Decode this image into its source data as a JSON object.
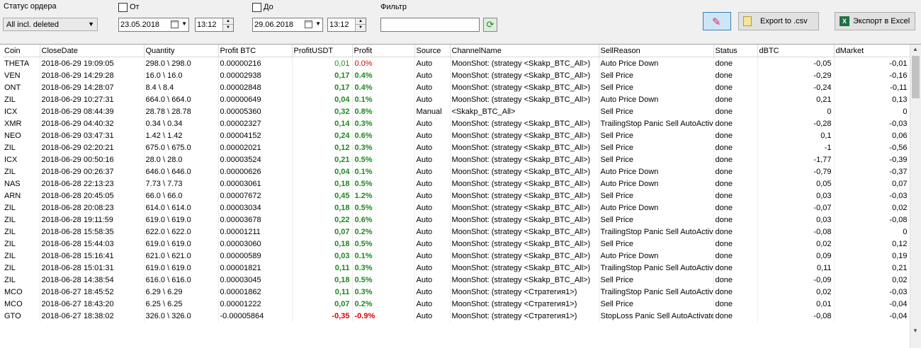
{
  "toolbar": {
    "status_label": "Статус ордера",
    "status_value": "All incl. deleted",
    "from_label": "От",
    "from_date": "23.05.2018",
    "from_time": "13:12",
    "to_label": "До",
    "to_date": "29.06.2018",
    "to_time": "13:12",
    "filter_label": "Фильтр",
    "filter_value": "",
    "export_csv": "Export to .csv",
    "export_excel": "Экспорт в Excel"
  },
  "columns": [
    "Coin",
    "CloseDate",
    "Quantity",
    "Profit BTC",
    "ProfitUSDT",
    "Profit",
    "Source",
    "ChannelName",
    "SellReason",
    "Status",
    "dBTC",
    "dMarket"
  ],
  "rows": [
    [
      "THETA",
      "2018-06-29 19:09:05",
      "298.0 \\ 298.0",
      "0.00000216",
      "0,01",
      "0.0%",
      "Auto",
      "MoonShot: (strategy <Skakp_BTC_All>)",
      "Auto Price Down",
      "done",
      "-0,05",
      "-0,01"
    ],
    [
      "VEN",
      "2018-06-29 14:29:28",
      "16.0 \\ 16.0",
      "0.00002938",
      "0,17",
      "0.4%",
      "Auto",
      "MoonShot: (strategy <Skakp_BTC_All>)",
      "Sell Price",
      "done",
      "-0,29",
      "-0,16"
    ],
    [
      "ONT",
      "2018-06-29 14:28:07",
      "8.4 \\ 8.4",
      "0.00002848",
      "0,17",
      "0.4%",
      "Auto",
      "MoonShot: (strategy <Skakp_BTC_All>)",
      "Sell Price",
      "done",
      "-0,24",
      "-0,11"
    ],
    [
      "ZIL",
      "2018-06-29 10:27:31",
      "664.0 \\ 664.0",
      "0.00000649",
      "0,04",
      "0.1%",
      "Auto",
      "MoonShot: (strategy <Skakp_BTC_All>)",
      "Auto Price Down",
      "done",
      "0,21",
      "0,13"
    ],
    [
      "ICX",
      "2018-06-29 08:44:39",
      "28.78 \\ 28.78",
      "0.00005360",
      "0,32",
      "0.8%",
      "Manual",
      " <Skakp_BTC_All>",
      "Sell Price",
      "done",
      "0",
      "0"
    ],
    [
      "XMR",
      "2018-06-29 04:40:32",
      "0.34 \\ 0.34",
      "0.00002327",
      "0,14",
      "0.3%",
      "Auto",
      "MoonShot: (strategy <Skakp_BTC_All>)",
      "TrailingStop Panic Sell AutoActivated",
      "done",
      "-0,28",
      "-0,03"
    ],
    [
      "NEO",
      "2018-06-29 03:47:31",
      "1.42 \\ 1.42",
      "0.00004152",
      "0,24",
      "0.6%",
      "Auto",
      "MoonShot: (strategy <Skakp_BTC_All>)",
      "Sell Price",
      "done",
      "0,1",
      "0,06"
    ],
    [
      "ZIL",
      "2018-06-29 02:20:21",
      "675.0 \\ 675.0",
      "0.00002021",
      "0,12",
      "0.3%",
      "Auto",
      "MoonShot: (strategy <Skakp_BTC_All>)",
      "Sell Price",
      "done",
      "-1",
      "-0,56"
    ],
    [
      "ICX",
      "2018-06-29 00:50:16",
      "28.0 \\ 28.0",
      "0.00003524",
      "0,21",
      "0.5%",
      "Auto",
      "MoonShot: (strategy <Skakp_BTC_All>)",
      "Sell Price",
      "done",
      "-1,77",
      "-0,39"
    ],
    [
      "ZIL",
      "2018-06-29 00:26:37",
      "646.0 \\ 646.0",
      "0.00000626",
      "0,04",
      "0.1%",
      "Auto",
      "MoonShot: (strategy <Skakp_BTC_All>)",
      "Auto Price Down",
      "done",
      "-0,79",
      "-0,37"
    ],
    [
      "NAS",
      "2018-06-28 22:13:23",
      "7.73 \\ 7.73",
      "0.00003061",
      "0,18",
      "0.5%",
      "Auto",
      "MoonShot: (strategy <Skakp_BTC_All>)",
      "Auto Price Down",
      "done",
      "0,05",
      "0,07"
    ],
    [
      "ARN",
      "2018-06-28 20:45:05",
      "66.0 \\ 66.0",
      "0.00007672",
      "0,45",
      "1.2%",
      "Auto",
      "MoonShot: (strategy <Skakp_BTC_All>)",
      "Sell Price",
      "done",
      "0,03",
      "-0,03"
    ],
    [
      "ZIL",
      "2018-06-28 20:08:23",
      "614.0 \\ 614.0",
      "0.00003034",
      "0,18",
      "0.5%",
      "Auto",
      "MoonShot: (strategy <Skakp_BTC_All>)",
      "Auto Price Down",
      "done",
      "-0,07",
      "0,02"
    ],
    [
      "ZIL",
      "2018-06-28 19:11:59",
      "619.0 \\ 619.0",
      "0.00003678",
      "0,22",
      "0.6%",
      "Auto",
      "MoonShot: (strategy <Skakp_BTC_All>)",
      "Sell Price",
      "done",
      "0,03",
      "-0,08"
    ],
    [
      "ZIL",
      "2018-06-28 15:58:35",
      "622.0 \\ 622.0",
      "0.00001211",
      "0,07",
      "0.2%",
      "Auto",
      "MoonShot: (strategy <Skakp_BTC_All>)",
      "TrailingStop Panic Sell AutoActivated",
      "done",
      "-0,08",
      "0"
    ],
    [
      "ZIL",
      "2018-06-28 15:44:03",
      "619.0 \\ 619.0",
      "0.00003060",
      "0,18",
      "0.5%",
      "Auto",
      "MoonShot: (strategy <Skakp_BTC_All>)",
      "Sell Price",
      "done",
      "0,02",
      "0,12"
    ],
    [
      "ZIL",
      "2018-06-28 15:16:41",
      "621.0 \\ 621.0",
      "0.00000589",
      "0,03",
      "0.1%",
      "Auto",
      "MoonShot: (strategy <Skakp_BTC_All>)",
      "Auto Price Down",
      "done",
      "0,09",
      "0,19"
    ],
    [
      "ZIL",
      "2018-06-28 15:01:31",
      "619.0 \\ 619.0",
      "0.00001821",
      "0,11",
      "0.3%",
      "Auto",
      "MoonShot: (strategy <Skakp_BTC_All>)",
      "TrailingStop Panic Sell AutoActivated",
      "done",
      "0,11",
      "0,21"
    ],
    [
      "ZIL",
      "2018-06-28 14:38:54",
      "616.0 \\ 616.0",
      "0.00003045",
      "0,18",
      "0.5%",
      "Auto",
      "MoonShot: (strategy <Skakp_BTC_All>)",
      "Sell Price",
      "done",
      "-0,09",
      "0,02"
    ],
    [
      "MCO",
      "2018-06-27 18:45:52",
      "6.29 \\ 6.29",
      "0.00001862",
      "0,11",
      "0.3%",
      "Auto",
      "MoonShot: (strategy <Стратегия1>)",
      "TrailingStop Panic Sell AutoActivated",
      "done",
      "0,02",
      "-0,03"
    ],
    [
      "MCO",
      "2018-06-27 18:43:20",
      "6.25 \\ 6.25",
      "0.00001222",
      "0,07",
      "0.2%",
      "Auto",
      "MoonShot: (strategy <Стратегия1>)",
      "Sell Price",
      "done",
      "0,01",
      "-0,04"
    ],
    [
      "GTO",
      "2018-06-27 18:38:02",
      "326.0 \\ 326.0",
      "-0.00005864",
      "-0,35",
      "-0.9%",
      "Auto",
      "MoonShot: (strategy <Стратегия1>)",
      "StopLoss Panic Sell AutoActivated",
      "done",
      "-0,08",
      "-0,04"
    ]
  ],
  "colors": {
    "positive": "#1a8a1a",
    "negative": "#e00000"
  }
}
